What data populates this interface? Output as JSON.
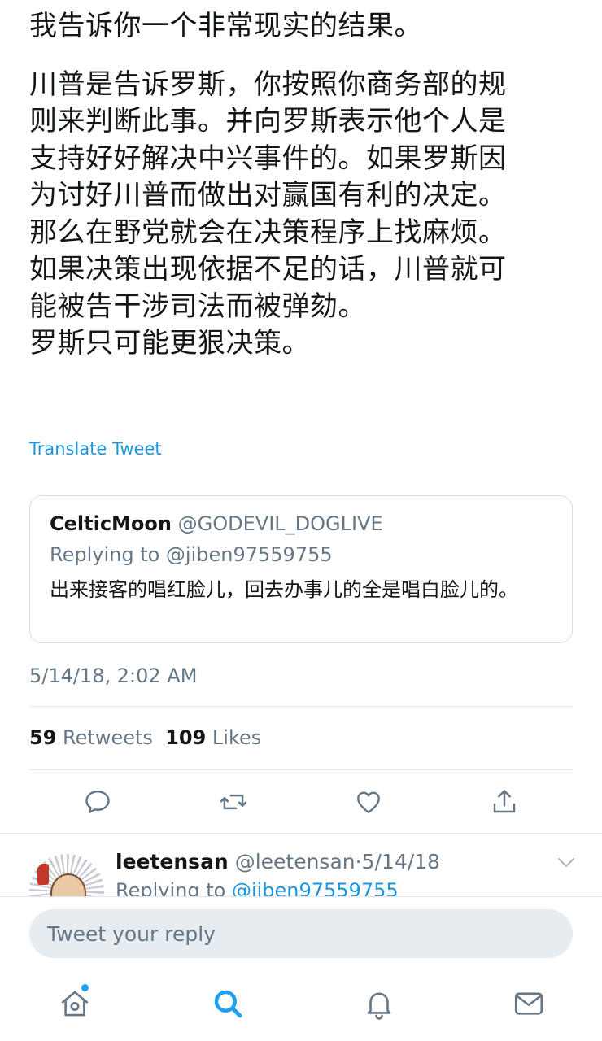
{
  "tweet": {
    "lines": [
      "我告诉你一个非常现实的结果。",
      "川普是告诉罗斯，你按照你商务部的规",
      "则来判断此事。并向罗斯表示他个人是",
      "支持好好解决中兴事件的。如果罗斯因",
      "为讨好川普而做出对赢国有利的决定。",
      "那么在野党就会在决策程序上找麻烦。",
      "如果决策出现依据不足的话，川普就可",
      "能被告干涉司法而被弹劾。",
      "罗斯只可能更狠决策。"
    ],
    "translate_label": "Translate Tweet",
    "timestamp": "5/14/18, 2:02 AM",
    "retweets_count": "59",
    "retweets_label": "Retweets",
    "likes_count": "109",
    "likes_label": "Likes"
  },
  "quoted": {
    "name": "CelticMoon",
    "handle": "@GODEVIL_DOGLIVE",
    "replying_to": "Replying to @jiben97559755",
    "text": "出来接客的唱红脸儿，回去办事儿的全是唱白脸儿的。"
  },
  "actions": {
    "reply_icon": "reply-icon",
    "retweet_icon": "retweet-icon",
    "like_icon": "heart-icon",
    "share_icon": "share-icon"
  },
  "reply": {
    "name": "leetensan",
    "handle": "@leetensan",
    "separator": "·",
    "date": "5/14/18",
    "replying_prefix": "Replying to",
    "replying_mention": "@jiben97559755"
  },
  "composer": {
    "placeholder": "Tweet your reply"
  },
  "nav": {
    "items": [
      "home-icon",
      "search-icon",
      "notifications-icon",
      "messages-icon"
    ],
    "active": "search-icon"
  },
  "colors": {
    "link": "#1b95e0",
    "secondary_text": "#657786",
    "divider": "#e1e8ed",
    "icon": "#657786",
    "active_nav": "#1da1f2"
  }
}
